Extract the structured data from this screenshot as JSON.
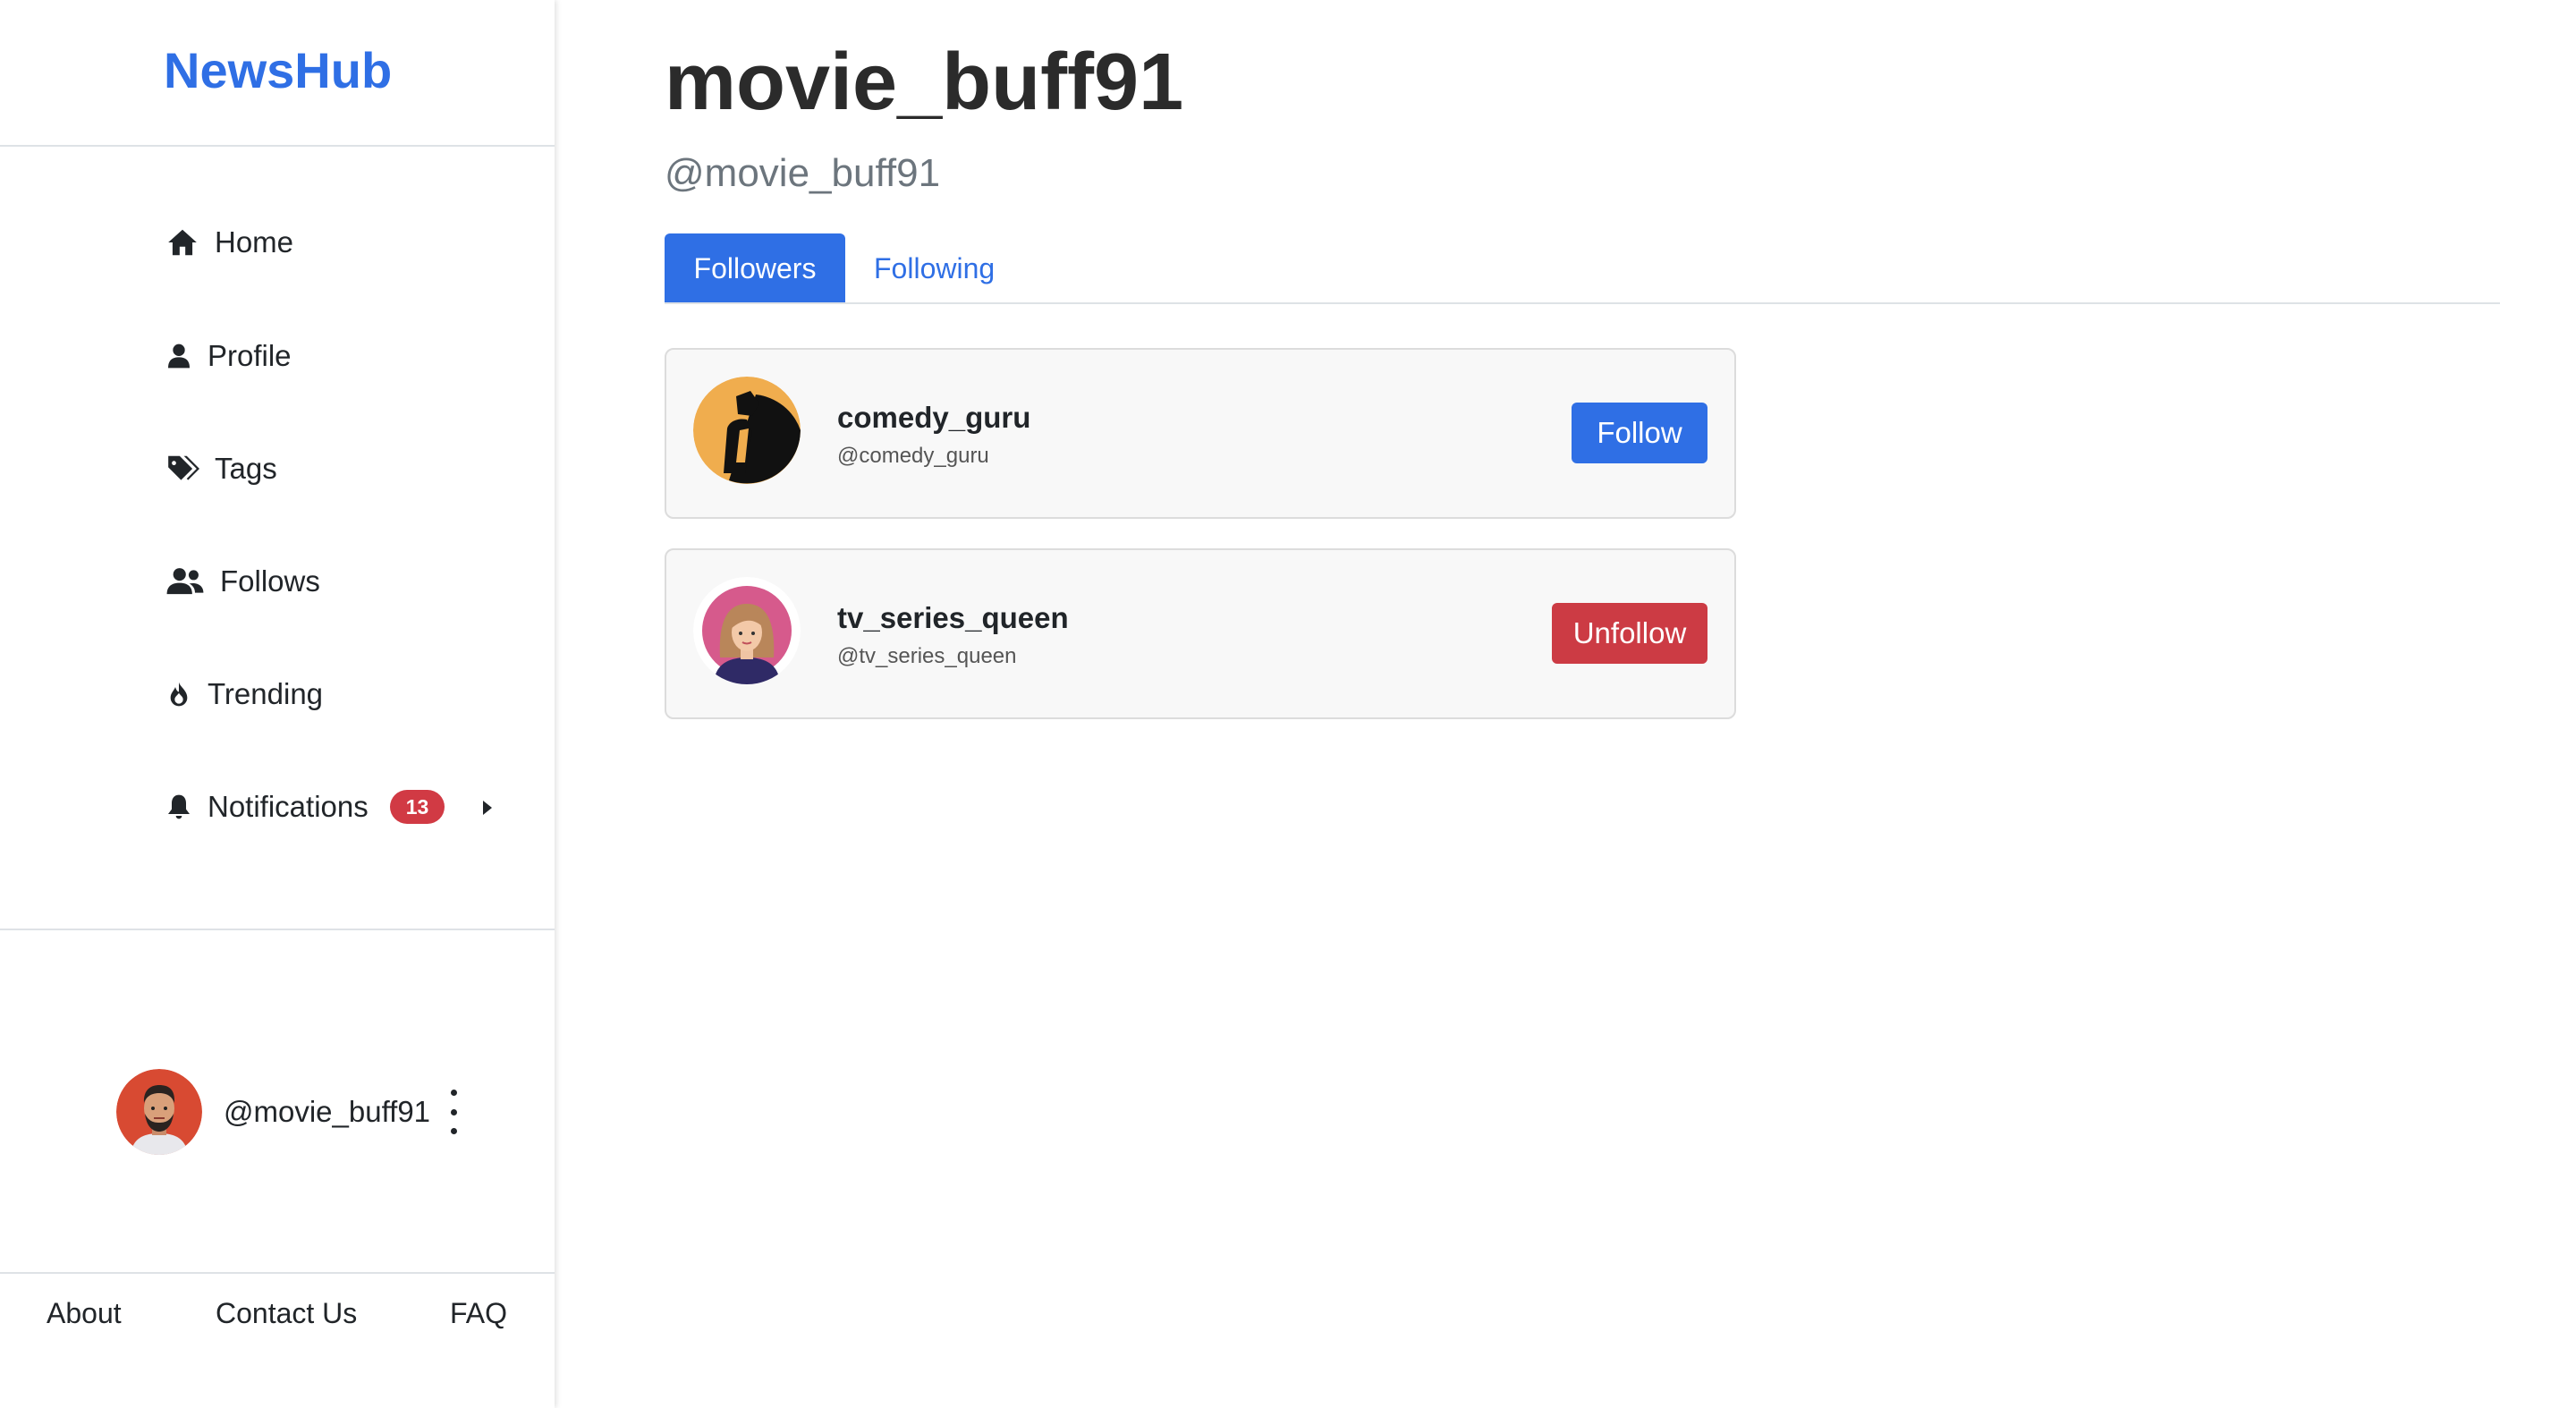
{
  "brand": {
    "name": "NewsHub",
    "color": "#2f6fe5"
  },
  "sidebar": {
    "items": [
      {
        "label": "Home",
        "icon": "home-icon"
      },
      {
        "label": "Profile",
        "icon": "user-icon"
      },
      {
        "label": "Tags",
        "icon": "tags-icon"
      },
      {
        "label": "Follows",
        "icon": "users-icon"
      },
      {
        "label": "Trending",
        "icon": "fire-icon"
      },
      {
        "label": "Notifications",
        "icon": "bell-icon",
        "badge": "13"
      }
    ]
  },
  "current_user": {
    "handle": "@movie_buff91",
    "avatar": "bearded-man-avatar"
  },
  "footer": {
    "links": [
      "About",
      "Contact Us",
      "FAQ"
    ]
  },
  "profile": {
    "title": "movie_buff91",
    "handle": "@movie_buff91"
  },
  "tabs": [
    {
      "label": "Followers",
      "active": true
    },
    {
      "label": "Following",
      "active": false
    }
  ],
  "followers": [
    {
      "name": "comedy_guru",
      "handle": "@comedy_guru",
      "action": "Follow",
      "avatar": "silhouette-avatar",
      "action_color": "#2f6fe5"
    },
    {
      "name": "tv_series_queen",
      "handle": "@tv_series_queen",
      "action": "Unfollow",
      "avatar": "woman-avatar",
      "action_color": "#cc3b44"
    }
  ]
}
